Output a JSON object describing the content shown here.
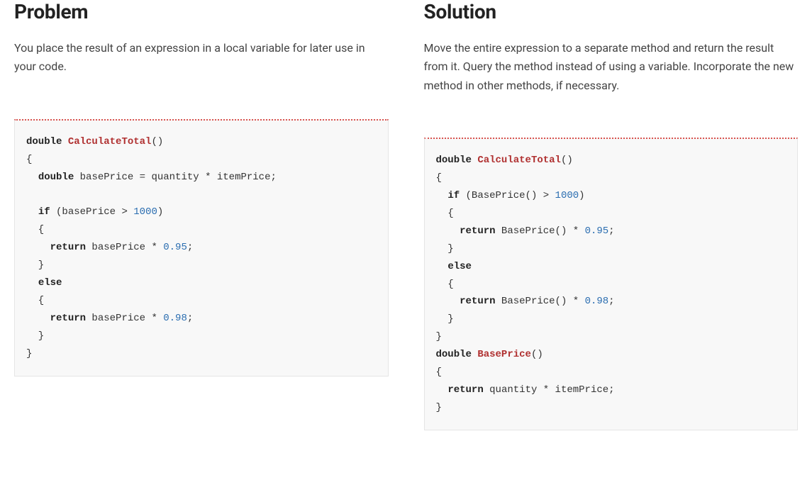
{
  "problem": {
    "heading": "Problem",
    "description": "You place the result of an expression in a local variable for later use in your code.",
    "code": {
      "line1_kw": "double",
      "line1_fn": "CalculateTotal",
      "line1_rest": "()",
      "line2": "{",
      "line3_indent": "  ",
      "line3_kw": "double",
      "line3_rest": " basePrice = quantity * itemPrice;",
      "line4": "",
      "line5_indent": "  ",
      "line5_kw": "if",
      "line5_mid": " (basePrice > ",
      "line5_num": "1000",
      "line5_end": ")",
      "line6": "  {",
      "line7_indent": "    ",
      "line7_kw": "return",
      "line7_mid": " basePrice * ",
      "line7_num": "0.95",
      "line7_end": ";",
      "line8": "  }",
      "line9_indent": "  ",
      "line9_kw": "else",
      "line10": "  {",
      "line11_indent": "    ",
      "line11_kw": "return",
      "line11_mid": " basePrice * ",
      "line11_num": "0.98",
      "line11_end": ";",
      "line12": "  }",
      "line13": "}"
    }
  },
  "solution": {
    "heading": "Solution",
    "description": "Move the entire expression to a separate method and return the result from it. Query the method instead of using a variable. Incorporate the new method in other methods, if necessary.",
    "code": {
      "line1_kw": "double",
      "line1_fn": "CalculateTotal",
      "line1_rest": "()",
      "line2": "{",
      "line3_indent": "  ",
      "line3_kw": "if",
      "line3_mid": " (BasePrice() > ",
      "line3_num": "1000",
      "line3_end": ")",
      "line4": "  {",
      "line5_indent": "    ",
      "line5_kw": "return",
      "line5_mid": " BasePrice() * ",
      "line5_num": "0.95",
      "line5_end": ";",
      "line6": "  }",
      "line7_indent": "  ",
      "line7_kw": "else",
      "line8": "  {",
      "line9_indent": "    ",
      "line9_kw": "return",
      "line9_mid": " BasePrice() * ",
      "line9_num": "0.98",
      "line9_end": ";",
      "line10": "  }",
      "line11": "}",
      "line12_kw": "double",
      "line12_fn": "BasePrice",
      "line12_rest": "()",
      "line13": "{",
      "line14_indent": "  ",
      "line14_kw": "return",
      "line14_rest": " quantity * itemPrice;",
      "line15": "}"
    }
  }
}
